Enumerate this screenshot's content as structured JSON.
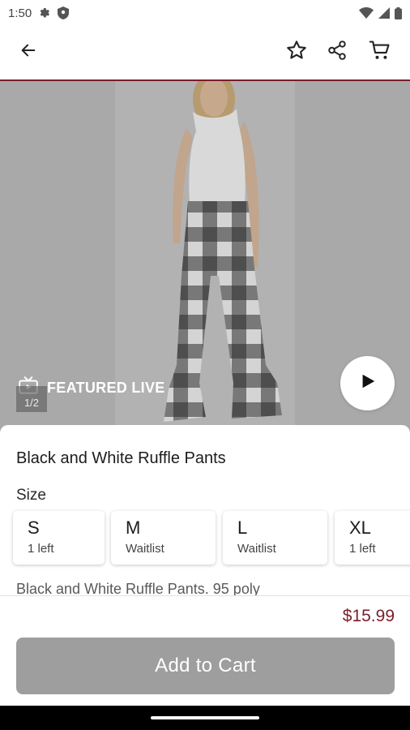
{
  "status_bar": {
    "time": "1:50"
  },
  "product": {
    "featured_label": "FEATURED LIVE",
    "image_counter": "1/2",
    "title": "Black and White Ruffle Pants",
    "size_heading": "Size",
    "sizes": [
      {
        "name": "S",
        "stock": "1 left"
      },
      {
        "name": "M",
        "stock": "Waitlist"
      },
      {
        "name": "L",
        "stock": "Waitlist"
      },
      {
        "name": "XL",
        "stock": "1 left"
      }
    ],
    "description": "Black and White Ruffle Pants. 95 poly",
    "price": "$15.99"
  },
  "actions": {
    "add_to_cart_label": "Add to Cart"
  },
  "colors": {
    "accent": "#7a1e2c",
    "button_disabled": "#9e9e9e",
    "overlay_gray": "#a9a9a9"
  },
  "icons": {
    "back": "arrow-left-icon",
    "favorite": "star-outline-icon",
    "share": "share-icon",
    "cart": "cart-icon",
    "featured": "live-tv-icon",
    "play": "play-icon"
  }
}
